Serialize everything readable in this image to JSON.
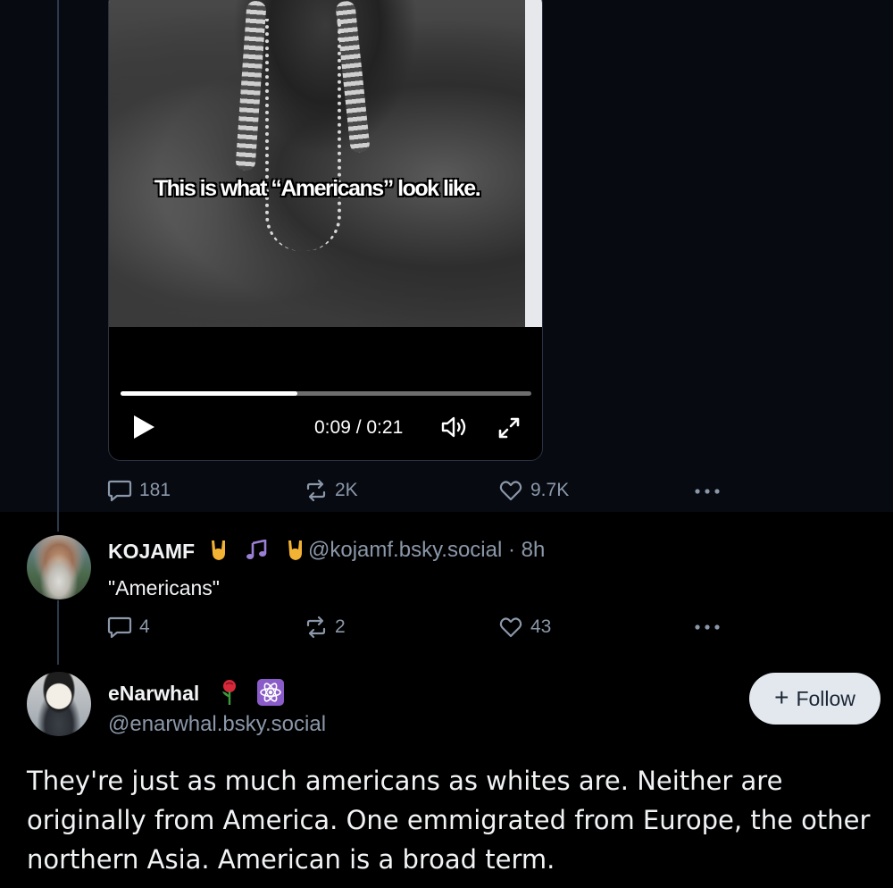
{
  "top_post": {
    "video": {
      "caption": "This is what “Americans” look like.",
      "progress": 0.43,
      "time": "0:09 / 0:21"
    },
    "actions": {
      "replies": "181",
      "reposts": "2K",
      "likes": "9.7K"
    }
  },
  "reply_1": {
    "display_name": "KOJAMF",
    "name_emojis": [
      "sign-of-horns",
      "musical-notes",
      "sign-of-horns"
    ],
    "handle_time": "@kojamf.bsky.social · 8h",
    "text": "\"Americans\"",
    "actions": {
      "replies": "4",
      "reposts": "2",
      "likes": "43"
    }
  },
  "reply_2": {
    "display_name": "eNarwhal",
    "name_emojis": [
      "rose",
      "atom-symbol"
    ],
    "handle": "@enarwhal.bsky.social",
    "follow_label": "Follow",
    "text": "They're just as much americans as whites are. Neither are originally from America. One emmigrated from Europe, the other northern Asia. American is a broad term."
  },
  "colors": {
    "background": "#000000",
    "thread_background": "#070a11",
    "muted_text": "#8b98a9",
    "primary_text": "#f1f3f5",
    "follow_button_bg": "#e3e8ef"
  }
}
